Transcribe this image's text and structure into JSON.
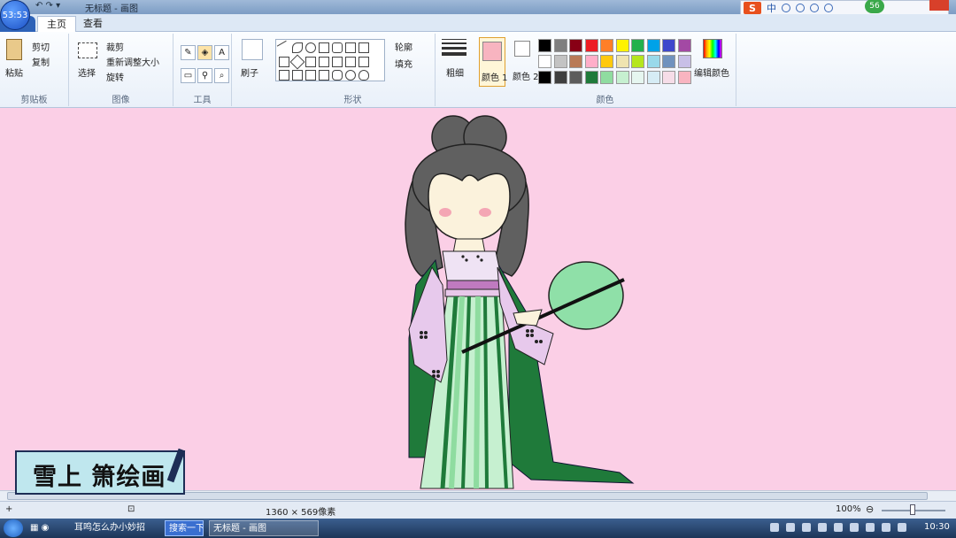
{
  "window": {
    "clock": "53:53",
    "title": "无标题 - 画图",
    "quick_access": "↶ ↷ ▾"
  },
  "ime": {
    "brand": "S",
    "mode": "中",
    "score": "56"
  },
  "tabs": [
    {
      "label": "主页"
    },
    {
      "label": "查看"
    }
  ],
  "ribbon": {
    "clipboard": {
      "paste": "粘贴",
      "cut": "剪切",
      "copy": "复制",
      "label": "剪贴板"
    },
    "image": {
      "select": "选择",
      "crop": "裁剪",
      "resize": "重新调整大小",
      "rotate": "旋转",
      "label": "图像"
    },
    "tools": {
      "label": "工具",
      "text_tool": "A"
    },
    "brushes": {
      "label": "刷子"
    },
    "shapes": {
      "outline": "轮廓",
      "fill": "填充",
      "label": "形状"
    },
    "size": {
      "label": "粗细"
    },
    "colors": {
      "color1": "颜色 1",
      "color2": "颜色 2",
      "edit": "编辑颜色",
      "label": "颜色",
      "color1_value": "#f8b4c0",
      "color2_value": "#ffffff",
      "palette": [
        "#000000",
        "#7f7f7f",
        "#880015",
        "#ed1c24",
        "#ff7f27",
        "#fff200",
        "#22b14c",
        "#00a2e8",
        "#3f48cc",
        "#a349a4",
        "#ffffff",
        "#c3c3c3",
        "#b97a57",
        "#ffaec9",
        "#ffc90e",
        "#efe4b0",
        "#b5e61d",
        "#99d9ea",
        "#7092be",
        "#c8bfe7",
        "#000000",
        "#3f3f3f",
        "#5c5c5c",
        "#1f7a3a",
        "#8fdca0",
        "#c6f0d0",
        "#e6f6f0",
        "#d6ecf5",
        "#f6dde8",
        "#f8b4c0"
      ]
    }
  },
  "canvas": {
    "background": "#fbcfe6"
  },
  "logo": {
    "text": "雪上 箫绘画"
  },
  "status": {
    "dimensions": "1360 × 569像素",
    "zoom": "100%"
  },
  "taskbar": {
    "task1": "耳鸣怎么办小妙招",
    "search": "搜索一下",
    "paint": "无标题 - 画图",
    "time": "10:30"
  }
}
